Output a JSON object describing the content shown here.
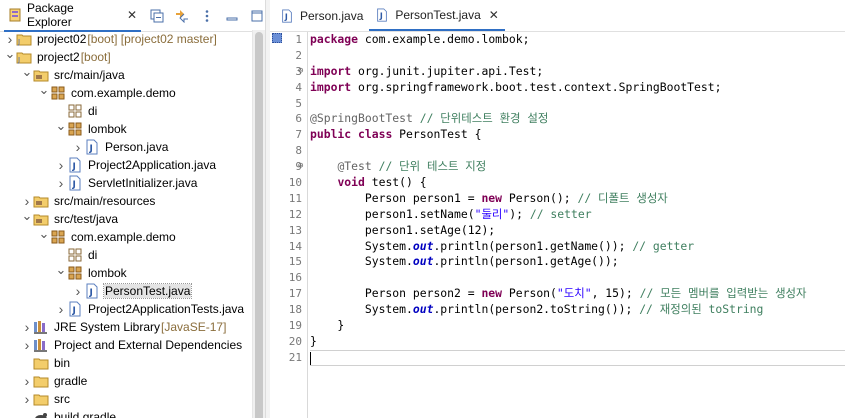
{
  "explorer": {
    "tab_label": "Package Explorer",
    "close_glyph": "✕",
    "tools": [
      "collapse-all-icon",
      "link-with-editor-icon",
      "view-menu-icon",
      "minimize-icon",
      "maximize-icon"
    ],
    "items": [
      {
        "label": "project02",
        "deco": " [boot] [project02 master]",
        "indent": 0,
        "arrow": "right",
        "icon": "project-icon"
      },
      {
        "label": "project2",
        "deco": " [boot]",
        "indent": 0,
        "arrow": "down",
        "icon": "project-icon"
      },
      {
        "label": "src/main/java",
        "deco": "",
        "indent": 1,
        "arrow": "down",
        "icon": "source-folder-icon"
      },
      {
        "label": "com.example.demo",
        "deco": "",
        "indent": 2,
        "arrow": "down",
        "icon": "package-icon"
      },
      {
        "label": "di",
        "deco": "",
        "indent": 3,
        "arrow": "none",
        "icon": "empty-package-icon"
      },
      {
        "label": "lombok",
        "deco": "",
        "indent": 3,
        "arrow": "down",
        "icon": "package-icon"
      },
      {
        "label": "Person.java",
        "deco": "",
        "indent": 4,
        "arrow": "right",
        "icon": "java-file-icon"
      },
      {
        "label": "Project2Application.java",
        "deco": "",
        "indent": 3,
        "arrow": "right",
        "icon": "java-file-icon"
      },
      {
        "label": "ServletInitializer.java",
        "deco": "",
        "indent": 3,
        "arrow": "right",
        "icon": "java-file-icon"
      },
      {
        "label": "src/main/resources",
        "deco": "",
        "indent": 1,
        "arrow": "right",
        "icon": "source-folder-icon"
      },
      {
        "label": "src/test/java",
        "deco": "",
        "indent": 1,
        "arrow": "down",
        "icon": "source-folder-icon"
      },
      {
        "label": "com.example.demo",
        "deco": "",
        "indent": 2,
        "arrow": "down",
        "icon": "package-icon"
      },
      {
        "label": "di",
        "deco": "",
        "indent": 3,
        "arrow": "none",
        "icon": "empty-package-icon"
      },
      {
        "label": "lombok",
        "deco": "",
        "indent": 3,
        "arrow": "down",
        "icon": "package-icon"
      },
      {
        "label": "PersonTest.java",
        "deco": "",
        "indent": 4,
        "arrow": "right",
        "icon": "java-file-icon",
        "selected": true
      },
      {
        "label": "Project2ApplicationTests.java",
        "deco": "",
        "indent": 3,
        "arrow": "right",
        "icon": "java-file-icon"
      },
      {
        "label": "JRE System Library",
        "deco": " [JavaSE-17]",
        "indent": 1,
        "arrow": "right",
        "icon": "library-icon"
      },
      {
        "label": "Project and External Dependencies",
        "deco": "",
        "indent": 1,
        "arrow": "right",
        "icon": "library-icon"
      },
      {
        "label": "bin",
        "deco": "",
        "indent": 1,
        "arrow": "none",
        "icon": "folder-icon"
      },
      {
        "label": "gradle",
        "deco": "",
        "indent": 1,
        "arrow": "right",
        "icon": "folder-icon"
      },
      {
        "label": "src",
        "deco": "",
        "indent": 1,
        "arrow": "right",
        "icon": "folder-icon"
      },
      {
        "label": "build.gradle",
        "deco": "",
        "indent": 1,
        "arrow": "none",
        "icon": "gradle-file-icon"
      }
    ]
  },
  "editor": {
    "tabs": [
      {
        "label": "Person.java",
        "active": false
      },
      {
        "label": "PersonTest.java",
        "active": true
      }
    ],
    "close_glyph": "✕",
    "current_line": 21,
    "lines": [
      [
        [
          "kw",
          "package"
        ],
        [
          "t",
          " com.example.demo.lombok;"
        ]
      ],
      [],
      [
        [
          "kw",
          "import"
        ],
        [
          "t",
          " org.junit.jupiter.api.Test;"
        ]
      ],
      [
        [
          "kw",
          "import"
        ],
        [
          "t",
          " org.springframework.boot.test.context.SpringBootTest;"
        ]
      ],
      [],
      [
        [
          "ann",
          "@SpringBootTest"
        ],
        [
          "t",
          " "
        ],
        [
          "cm",
          "// 단위테스트 환경 설정"
        ]
      ],
      [
        [
          "kw",
          "public"
        ],
        [
          "t",
          " "
        ],
        [
          "kw",
          "class"
        ],
        [
          "t",
          " PersonTest {"
        ]
      ],
      [],
      [
        [
          "t",
          "    "
        ],
        [
          "ann",
          "@Test"
        ],
        [
          "t",
          " "
        ],
        [
          "cm",
          "// 단위 테스트 지정"
        ]
      ],
      [
        [
          "t",
          "    "
        ],
        [
          "kw",
          "void"
        ],
        [
          "t",
          " test() {"
        ]
      ],
      [
        [
          "t",
          "        Person person1 = "
        ],
        [
          "kw",
          "new"
        ],
        [
          "t",
          " Person(); "
        ],
        [
          "cm",
          "// 디폴트 생성자"
        ]
      ],
      [
        [
          "t",
          "        person1.setName("
        ],
        [
          "str",
          "\"둘리\""
        ],
        [
          "t",
          "); "
        ],
        [
          "cm",
          "// setter"
        ]
      ],
      [
        [
          "t",
          "        person1.setAge(12);"
        ]
      ],
      [
        [
          "t",
          "        System."
        ],
        [
          "fld",
          "out"
        ],
        [
          "t",
          ".println(person1.getName()); "
        ],
        [
          "cm",
          "// getter"
        ]
      ],
      [
        [
          "t",
          "        System."
        ],
        [
          "fld",
          "out"
        ],
        [
          "t",
          ".println(person1.getAge());"
        ]
      ],
      [],
      [
        [
          "t",
          "        Person person2 = "
        ],
        [
          "kw",
          "new"
        ],
        [
          "t",
          " Person("
        ],
        [
          "str",
          "\"도치\""
        ],
        [
          "t",
          ", 15); "
        ],
        [
          "cm",
          "// 모든 멤버를 입력받는 생성자"
        ]
      ],
      [
        [
          "t",
          "        System."
        ],
        [
          "fld",
          "out"
        ],
        [
          "t",
          ".println(person2.toString()); "
        ],
        [
          "cm",
          "// 재정의된 toString"
        ]
      ],
      [
        [
          "t",
          "    }"
        ]
      ],
      [
        [
          "t",
          "}"
        ]
      ],
      []
    ],
    "fold_lines": [
      3,
      9
    ]
  }
}
